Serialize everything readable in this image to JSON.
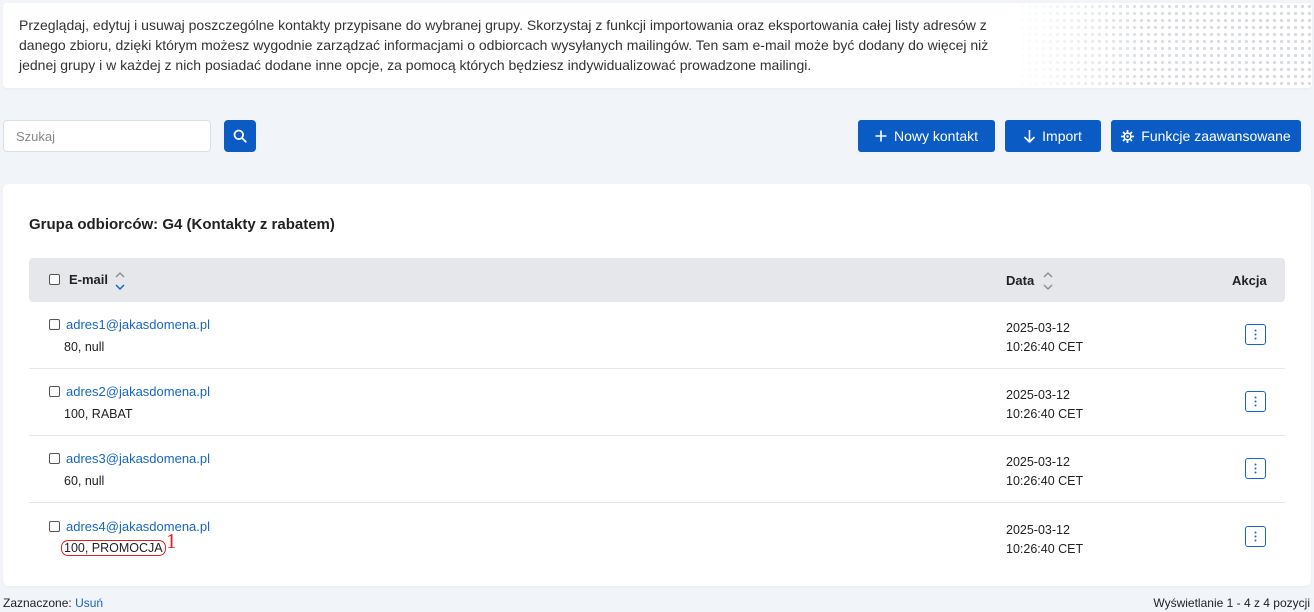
{
  "info": {
    "text": "Przeglądaj, edytuj i usuwaj poszczególne kontakty przypisane do wybranej grupy. Skorzystaj z funkcji importowania oraz eksportowania całej listy adresów z danego zbioru, dzięki którym możesz wygodnie zarządzać informacjami o odbiorcach wysyłanych mailingów. Ten sam e-mail może być dodany do więcej niż jednej grupy i w każdej z nich posiadać dodane inne opcje, za pomocą których będziesz indywidualizować prowadzone mailingi."
  },
  "search": {
    "placeholder": "Szukaj",
    "icon": "search-icon"
  },
  "toolbar": {
    "new_contact_label": "Nowy kontakt",
    "import_label": "Import",
    "advanced_label": "Funkcje zaawansowane"
  },
  "group": {
    "title": "Grupa odbiorców: G4 (Kontakty z rabatem)"
  },
  "table": {
    "headers": {
      "email": "E-mail",
      "date": "Data",
      "action": "Akcja"
    },
    "rows": [
      {
        "email": "adres1@jakasdomena.pl",
        "meta": "80, null",
        "date": "2025-03-12",
        "time": "10:26:40 CET"
      },
      {
        "email": "adres2@jakasdomena.pl",
        "meta": "100, RABAT",
        "date": "2025-03-12",
        "time": "10:26:40 CET"
      },
      {
        "email": "adres3@jakasdomena.pl",
        "meta": "60, null",
        "date": "2025-03-12",
        "time": "10:26:40 CET"
      },
      {
        "email": "adres4@jakasdomena.pl",
        "meta": "100, PROMOCJA",
        "date": "2025-03-12",
        "time": "10:26:40 CET"
      }
    ]
  },
  "annotation": {
    "label": "1"
  },
  "footer": {
    "selected_label": "Zaznaczone:",
    "delete_link": "Usuń",
    "pagination": "Wyświetlanie 1 - 4 z 4 pozycji"
  },
  "colors": {
    "primary": "#0b5bc4",
    "link": "#1766c1",
    "highlight": "#dd2222",
    "background": "#f1f4f9"
  }
}
